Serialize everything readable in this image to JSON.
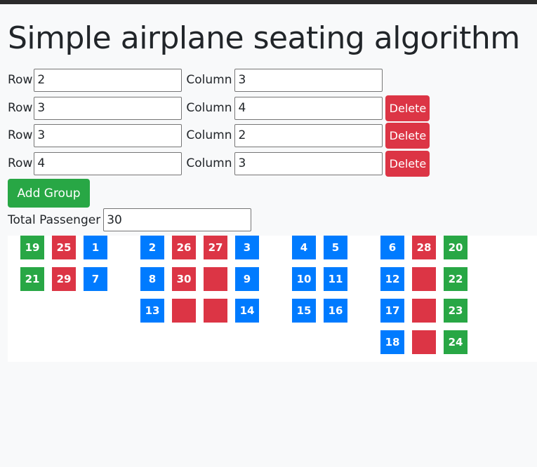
{
  "title": "Simple airplane seating algorithm",
  "labels": {
    "row": "Row",
    "column": "Column",
    "delete": "Delete",
    "add_group": "Add Group",
    "total_passenger": "Total Passenger"
  },
  "groups": [
    {
      "row": "2",
      "column": "3",
      "deletable": false
    },
    {
      "row": "3",
      "column": "4",
      "deletable": true
    },
    {
      "row": "3",
      "column": "2",
      "deletable": true
    },
    {
      "row": "4",
      "column": "3",
      "deletable": true
    }
  ],
  "total_passenger": "30",
  "colors": {
    "blue": "#007bff",
    "red": "#dc3545",
    "green": "#28a745"
  },
  "seat_groups": [
    {
      "columns": 3,
      "rows": [
        [
          {
            "n": "19",
            "t": "green"
          },
          {
            "n": "25",
            "t": "red"
          },
          {
            "n": "1",
            "t": "blue"
          }
        ],
        [
          {
            "n": "21",
            "t": "green"
          },
          {
            "n": "29",
            "t": "red"
          },
          {
            "n": "7",
            "t": "blue"
          }
        ]
      ]
    },
    {
      "columns": 4,
      "rows": [
        [
          {
            "n": "2",
            "t": "blue"
          },
          {
            "n": "26",
            "t": "red"
          },
          {
            "n": "27",
            "t": "red"
          },
          {
            "n": "3",
            "t": "blue"
          }
        ],
        [
          {
            "n": "8",
            "t": "blue"
          },
          {
            "n": "30",
            "t": "red"
          },
          {
            "n": "",
            "t": "red"
          },
          {
            "n": "9",
            "t": "blue"
          }
        ],
        [
          {
            "n": "13",
            "t": "blue"
          },
          {
            "n": "",
            "t": "red"
          },
          {
            "n": "",
            "t": "red"
          },
          {
            "n": "14",
            "t": "blue"
          }
        ]
      ]
    },
    {
      "columns": 2,
      "rows": [
        [
          {
            "n": "4",
            "t": "blue"
          },
          {
            "n": "5",
            "t": "blue"
          }
        ],
        [
          {
            "n": "10",
            "t": "blue"
          },
          {
            "n": "11",
            "t": "blue"
          }
        ],
        [
          {
            "n": "15",
            "t": "blue"
          },
          {
            "n": "16",
            "t": "blue"
          }
        ]
      ]
    },
    {
      "columns": 3,
      "rows": [
        [
          {
            "n": "6",
            "t": "blue"
          },
          {
            "n": "28",
            "t": "red"
          },
          {
            "n": "20",
            "t": "green"
          }
        ],
        [
          {
            "n": "12",
            "t": "blue"
          },
          {
            "n": "",
            "t": "red"
          },
          {
            "n": "22",
            "t": "green"
          }
        ],
        [
          {
            "n": "17",
            "t": "blue"
          },
          {
            "n": "",
            "t": "red"
          },
          {
            "n": "23",
            "t": "green"
          }
        ],
        [
          {
            "n": "18",
            "t": "blue"
          },
          {
            "n": "",
            "t": "red"
          },
          {
            "n": "24",
            "t": "green"
          }
        ]
      ]
    }
  ]
}
